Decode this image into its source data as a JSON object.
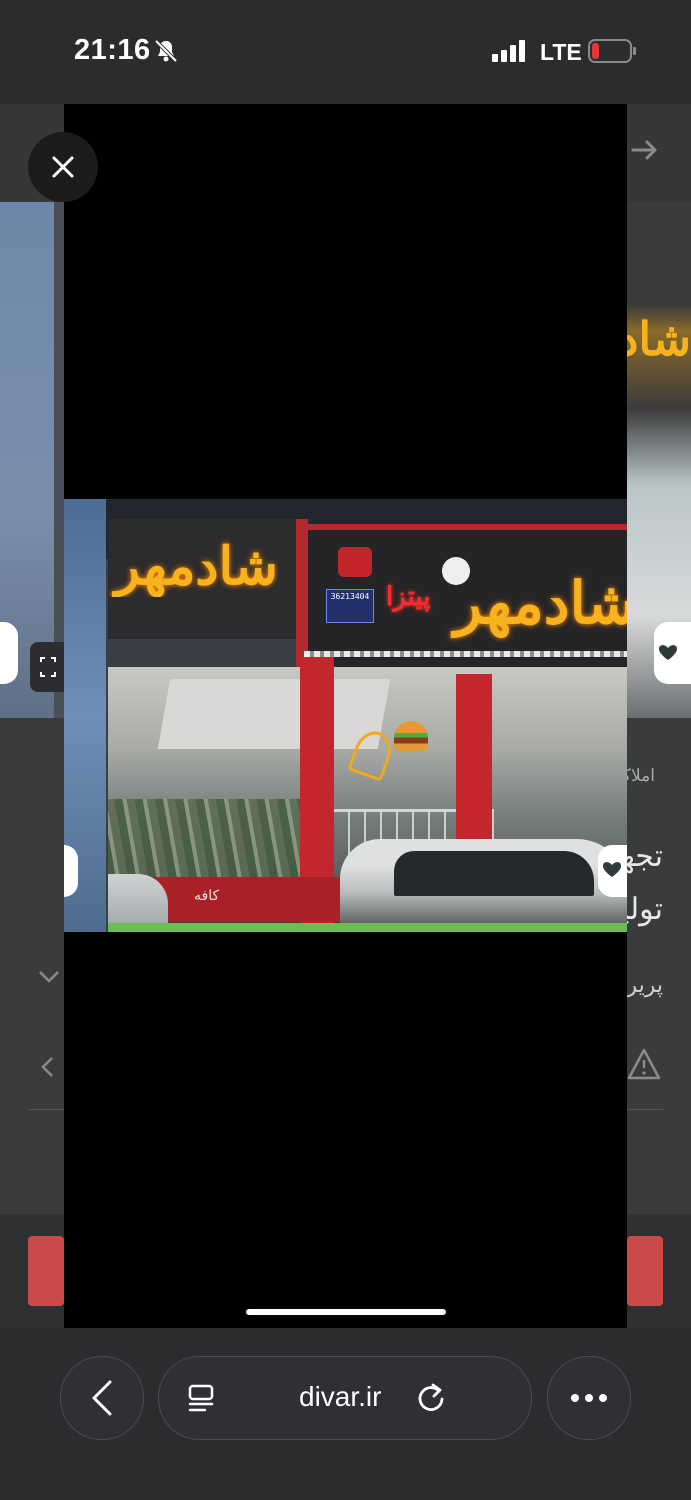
{
  "status_bar": {
    "time": "21:16",
    "network": "LTE",
    "battery_color": "#e5343a"
  },
  "background_page": {
    "breadcrumb": "املاک",
    "title_line1": "تجهیزات",
    "title_line2": "تولید",
    "subtitle": "پریروز",
    "accent_color": "#c94a49"
  },
  "photo": {
    "sign_main": "شادمهر",
    "sign_left": "شادمهر",
    "sign_pizza": "پیتزا",
    "sign_phone": "36213404",
    "base_label": "کافه"
  },
  "icons": {
    "close": "close-icon",
    "expand": "expand-icon",
    "heart": "heart-icon",
    "back": "chevron-left-icon",
    "reader": "reader-icon",
    "reload": "reload-icon",
    "more": "more-icon"
  },
  "browser": {
    "url": "divar.ir"
  }
}
